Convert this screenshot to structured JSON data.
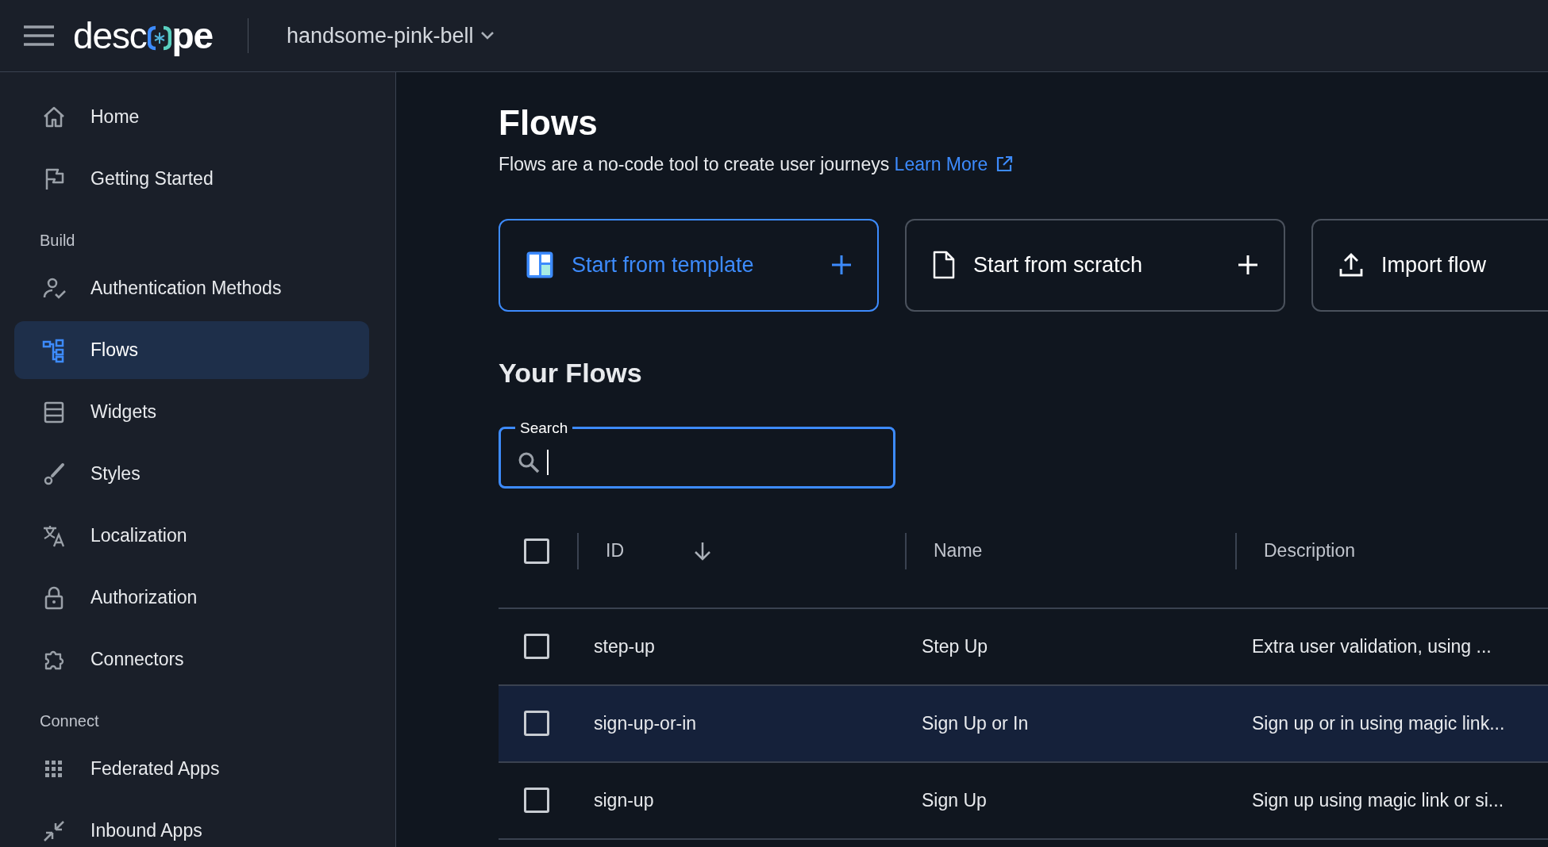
{
  "header": {
    "logo": {
      "before": "de**sc**",
      "after": "**pe**"
    },
    "project": "handsome-pink-bell"
  },
  "sidebar": {
    "items": [
      {
        "kind": "item",
        "label": "Home",
        "selected": false
      },
      {
        "kind": "item",
        "label": "Getting Started",
        "selected": false
      },
      {
        "kind": "heading",
        "label": "Build"
      },
      {
        "kind": "item",
        "label": "Authentication Methods",
        "selected": false
      },
      {
        "kind": "item",
        "label": "Flows",
        "selected": true
      },
      {
        "kind": "item",
        "label": "Widgets",
        "selected": false
      },
      {
        "kind": "item",
        "label": "Styles",
        "selected": false
      },
      {
        "kind": "item",
        "label": "Localization",
        "selected": false
      },
      {
        "kind": "item",
        "label": "Authorization",
        "selected": false
      },
      {
        "kind": "item",
        "label": "Connectors",
        "selected": false
      },
      {
        "kind": "heading",
        "label": "Connect"
      },
      {
        "kind": "item",
        "label": "Federated Apps",
        "selected": false
      },
      {
        "kind": "item",
        "label": "Inbound Apps",
        "selected": false
      }
    ]
  },
  "page": {
    "title": "Flows",
    "subtitle": "Flows are a no-code tool to create user journeys",
    "link": "Learn More",
    "actions": [
      {
        "kind": "template",
        "label": "Start from template",
        "highlighted": true
      },
      {
        "kind": "scratch",
        "label": "Start from scratch",
        "highlighted": false
      },
      {
        "kind": "import",
        "label": "Import flow",
        "highlighted": false
      }
    ],
    "section_title": "Your Flows",
    "search": {
      "label": "Search",
      "focused": true
    },
    "table": {
      "header_checked": false,
      "columns": [
        {
          "label": "ID",
          "sorted": true
        },
        {
          "label": "Name",
          "sorted": false
        },
        {
          "label": "Description",
          "sorted": false
        }
      ],
      "rows": [
        {
          "id": "step-up",
          "name": "Step Up",
          "description": "Extra user validation, using ...",
          "checked": false,
          "hovered": false
        },
        {
          "id": "sign-up-or-in",
          "name": "Sign Up or In",
          "description": "Sign up or in using magic link...",
          "checked": false,
          "hovered": true
        },
        {
          "id": "sign-up",
          "name": "Sign Up",
          "description": "Sign up using magic link or si...",
          "checked": false,
          "hovered": false
        }
      ]
    }
  }
}
